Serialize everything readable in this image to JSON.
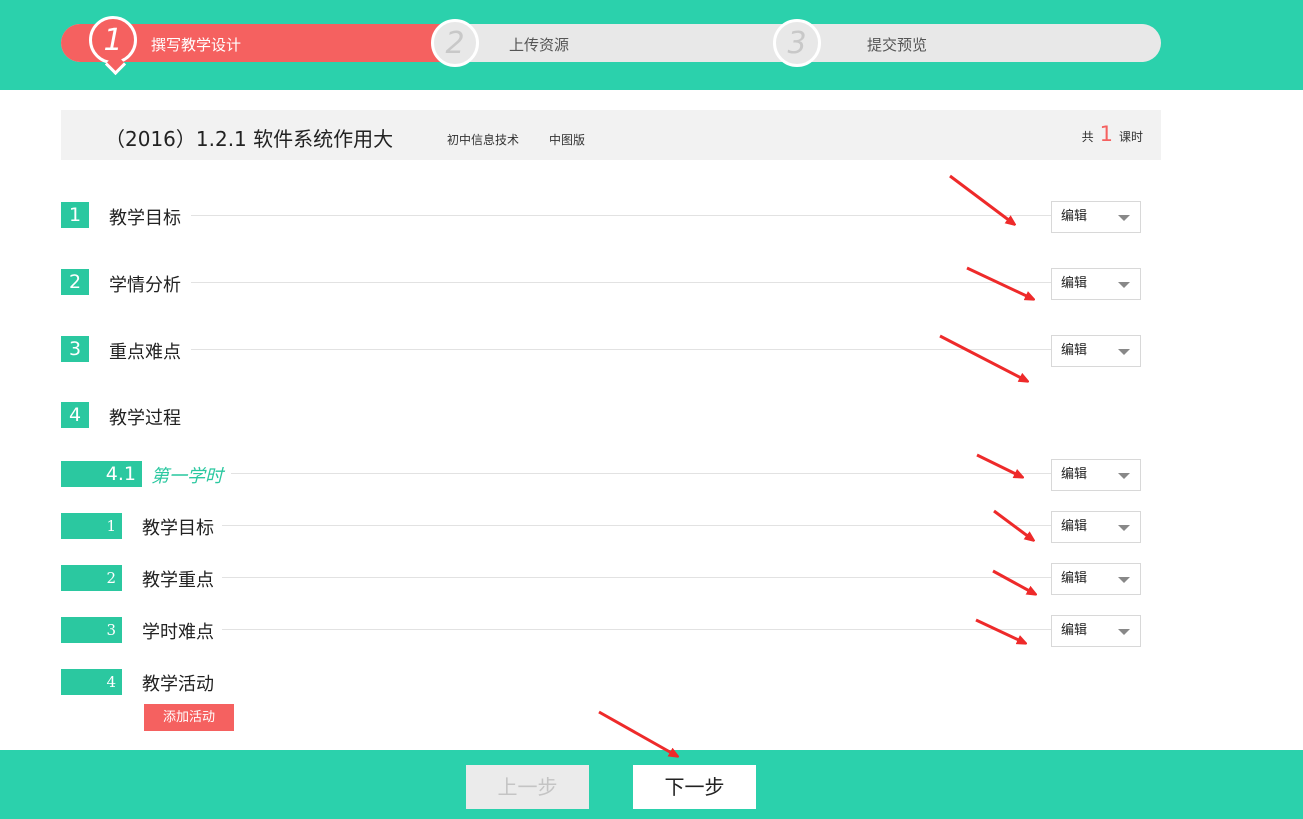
{
  "steps": [
    {
      "number": "1",
      "label": "撰写教学设计"
    },
    {
      "number": "2",
      "label": "上传资源"
    },
    {
      "number": "3",
      "label": "提交预览"
    }
  ],
  "course": {
    "title": "（2016）1.2.1 软件系统作用大",
    "subject": "初中信息技术",
    "publisher": "中图版",
    "total_prefix": "共",
    "total_count": "1",
    "total_suffix": "课时"
  },
  "sections": [
    {
      "number": "1",
      "label": "教学目标",
      "edit": "编辑"
    },
    {
      "number": "2",
      "label": "学情分析",
      "edit": "编辑"
    },
    {
      "number": "3",
      "label": "重点难点",
      "edit": "编辑"
    },
    {
      "number": "4",
      "label": "教学过程"
    }
  ],
  "phase": {
    "number": "4.1",
    "label": "第一学时",
    "edit": "编辑"
  },
  "sub_items": [
    {
      "number": "1",
      "label": "教学目标",
      "edit": "编辑"
    },
    {
      "number": "2",
      "label": "教学重点",
      "edit": "编辑"
    },
    {
      "number": "3",
      "label": "学时难点",
      "edit": "编辑"
    },
    {
      "number": "4",
      "label": "教学活动"
    }
  ],
  "add_activity": "添加活动",
  "footer": {
    "prev": "上一步",
    "next": "下一步"
  },
  "colors": {
    "brand": "#2bd1ac",
    "accent": "#f56160",
    "box": "#2bc8a0"
  }
}
